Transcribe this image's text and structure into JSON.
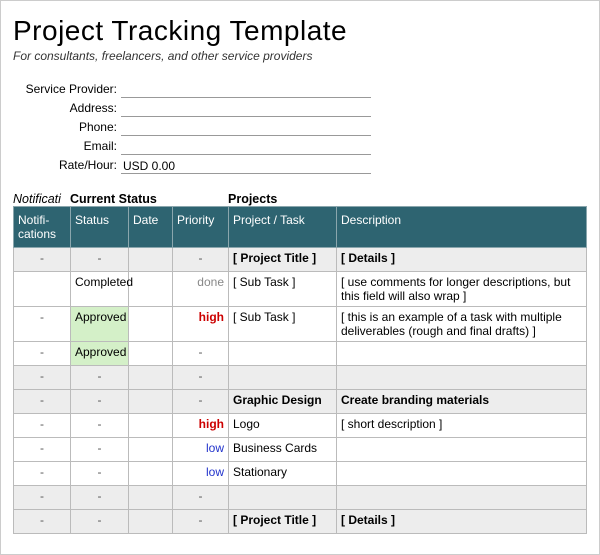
{
  "header": {
    "title": "Project Tracking Template",
    "subtitle": "For consultants, freelancers, and other service providers"
  },
  "info": {
    "provider_label": "Service Provider:",
    "provider_value": "",
    "address_label": "Address:",
    "address_value": "",
    "phone_label": "Phone:",
    "phone_value": "",
    "email_label": "Email:",
    "email_value": "",
    "rate_label": "Rate/Hour:",
    "rate_value": "USD 0.00"
  },
  "sections": {
    "notifications": "Notificati",
    "current_status": "Current Status",
    "projects": "Projects"
  },
  "columns": {
    "notifications": "Notifi-cations",
    "status": "Status",
    "date": "Date",
    "priority": "Priority",
    "project_task": "Project / Task",
    "description": "Description"
  },
  "rows": [
    {
      "type": "group",
      "notif": "-",
      "status": "-",
      "date": "",
      "priority": "-",
      "project": "[ Project Title ]",
      "description": "[ Details ]"
    },
    {
      "type": "data",
      "notif": "",
      "status": "Completed",
      "status_bg": "",
      "date": "",
      "priority": "done",
      "priority_class": "prio-done",
      "project": "[ Sub Task ]",
      "description": "[ use comments for longer descriptions, but this field will also wrap ]"
    },
    {
      "type": "data",
      "notif": "-",
      "status": "Approved",
      "status_bg": "approved",
      "date": "",
      "priority": "high",
      "priority_class": "prio-high",
      "project": "[ Sub Task ]",
      "description": "[ this is an example of a task with multiple deliverables (rough and final drafts) ]"
    },
    {
      "type": "data",
      "notif": "-",
      "status": "Approved",
      "status_bg": "approved",
      "date": "",
      "priority": "-",
      "priority_class": "dash",
      "project": "",
      "description": ""
    },
    {
      "type": "blank",
      "notif": "-",
      "status": "-",
      "date": "",
      "priority": "-",
      "project": "",
      "description": ""
    },
    {
      "type": "group",
      "notif": "-",
      "status": "-",
      "date": "",
      "priority": "-",
      "project": "Graphic Design",
      "description": "Create branding materials"
    },
    {
      "type": "data",
      "notif": "-",
      "status": "-",
      "date": "",
      "priority": "high",
      "priority_class": "prio-high",
      "project": "Logo",
      "description": "[ short description ]"
    },
    {
      "type": "data",
      "notif": "-",
      "status": "-",
      "date": "",
      "priority": "low",
      "priority_class": "prio-low",
      "project": "Business Cards",
      "description": ""
    },
    {
      "type": "data",
      "notif": "-",
      "status": "-",
      "date": "",
      "priority": "low",
      "priority_class": "prio-low",
      "project": "Stationary",
      "description": ""
    },
    {
      "type": "blank",
      "notif": "-",
      "status": "-",
      "date": "",
      "priority": "-",
      "project": "",
      "description": ""
    },
    {
      "type": "group",
      "notif": "-",
      "status": "-",
      "date": "",
      "priority": "-",
      "project": "[ Project Title ]",
      "description": "[ Details ]"
    }
  ]
}
